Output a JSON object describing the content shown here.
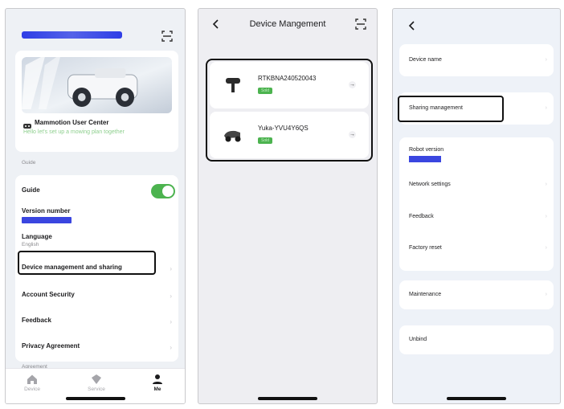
{
  "screen1": {
    "user_center_title": "Mammotion User Center",
    "user_center_subtitle": "Hello let's set up a mowing plan together",
    "section_guide": "Guide",
    "rows": {
      "guide": "Guide",
      "version_number": "Version number",
      "language": "Language",
      "language_value": "English",
      "device_management": "Device management and sharing",
      "account_security": "Account Security",
      "feedback": "Feedback",
      "privacy": "Privacy Agreement"
    },
    "guide_toggle_on": true,
    "section_agreement": "Agreement",
    "tabs": [
      {
        "label": "Device",
        "icon": "home-icon",
        "active": false
      },
      {
        "label": "Service",
        "icon": "service-icon",
        "active": false
      },
      {
        "label": "Me",
        "icon": "person-icon",
        "active": true
      }
    ]
  },
  "screen2": {
    "title": "Device Mangement",
    "devices": [
      {
        "name": "RTKBNA240520043",
        "badge": "Sold"
      },
      {
        "name": "Yuka-YVU4Y6QS",
        "badge": "Sold"
      }
    ]
  },
  "screen3": {
    "items": {
      "device_name": "Device name",
      "sharing": "Sharing management",
      "robot_version": "Robot version",
      "network": "Network settings",
      "feedback": "Feedback",
      "factory_reset": "Factory reset",
      "maintenance": "Maintenance",
      "unbind": "Unbind"
    }
  },
  "colors": {
    "accent_green": "#4cb34f",
    "redaction_blue": "#3a46e0",
    "highlight_border": "#111111"
  }
}
